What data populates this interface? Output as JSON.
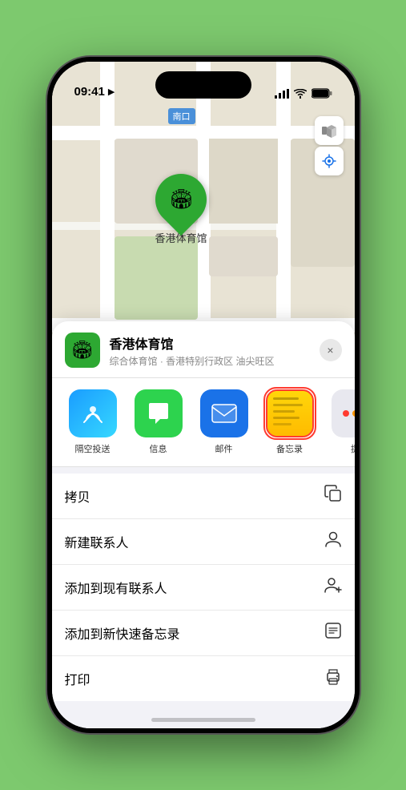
{
  "status_bar": {
    "time": "09:41",
    "location_arrow": "▶"
  },
  "map": {
    "label_text": "南口",
    "venue_pin_label": "香港体育馆"
  },
  "map_controls": {
    "map_icon": "🗺",
    "location_icon": "➤"
  },
  "sheet": {
    "venue_name": "香港体育馆",
    "venue_subtitle": "综合体育馆 · 香港特别行政区 油尖旺区",
    "close_label": "×"
  },
  "share_items": [
    {
      "id": "airdrop",
      "label": "隔空投送",
      "type": "airdrop"
    },
    {
      "id": "messages",
      "label": "信息",
      "type": "messages"
    },
    {
      "id": "mail",
      "label": "邮件",
      "type": "mail"
    },
    {
      "id": "notes",
      "label": "备忘录",
      "type": "notes"
    },
    {
      "id": "more",
      "label": "提",
      "type": "more"
    }
  ],
  "actions": [
    {
      "label": "拷贝",
      "icon": "copy"
    },
    {
      "label": "新建联系人",
      "icon": "person"
    },
    {
      "label": "添加到现有联系人",
      "icon": "person-add"
    },
    {
      "label": "添加到新快速备忘录",
      "icon": "note"
    },
    {
      "label": "打印",
      "icon": "print"
    }
  ],
  "more_dots": [
    {
      "color": "#ff3b30"
    },
    {
      "color": "#ff9500"
    },
    {
      "color": "#34c759"
    }
  ]
}
